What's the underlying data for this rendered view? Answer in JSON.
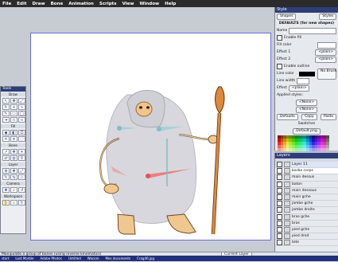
{
  "menu": [
    "File",
    "Edit",
    "Draw",
    "Bone",
    "Animation",
    "Scripts",
    "View",
    "Window",
    "Help"
  ],
  "tools": {
    "title": "Tools",
    "sections": [
      "Draw",
      "Fill",
      "Bone",
      "Layer",
      "Camera",
      "Workspace"
    ]
  },
  "style": {
    "title": "Style",
    "shapes_btn": "Shapes",
    "styles_btn": "Styles",
    "heading": "DEFAULTS (for new shapes)",
    "name_label": "Name",
    "enable_fill": "Enable fill",
    "fill_color": "Fill color",
    "effect1": "Effect 1",
    "effect2": "Effect 2",
    "plain": "<plain>",
    "enable_outline": "Enable outline",
    "line_color": "Line color",
    "line_width": "Line width",
    "effect": "Effect",
    "no_brush": "No Brush",
    "applied_styles": "Applied styles:",
    "none": "<None>",
    "copy": "Copy",
    "paste": "Paste",
    "defaults_btn": "Defaults",
    "swatches": "Swatches",
    "swatch_set": "Default.png"
  },
  "layers": {
    "title": "Layers",
    "items": [
      "Layer 11",
      "barbe corps",
      "main dessus",
      "baton",
      "main dessous",
      "main gche",
      "jambe gche",
      "jambe droite",
      "bras gche",
      "bras",
      "pied gche",
      "pied droit",
      "tete"
    ]
  },
  "status": {
    "text": "Manipulate a group of bones (using inverse kinematics)",
    "current_layer": "Current Layer"
  },
  "taskbar": [
    "start",
    "Lost Marble",
    "Adobe Photos",
    "Untitled",
    "Wacom",
    "Mes documents",
    "Crag40.jpg"
  ],
  "colors": {
    "accent": "#2d3e78",
    "frame_border": "#6b6fd8"
  }
}
